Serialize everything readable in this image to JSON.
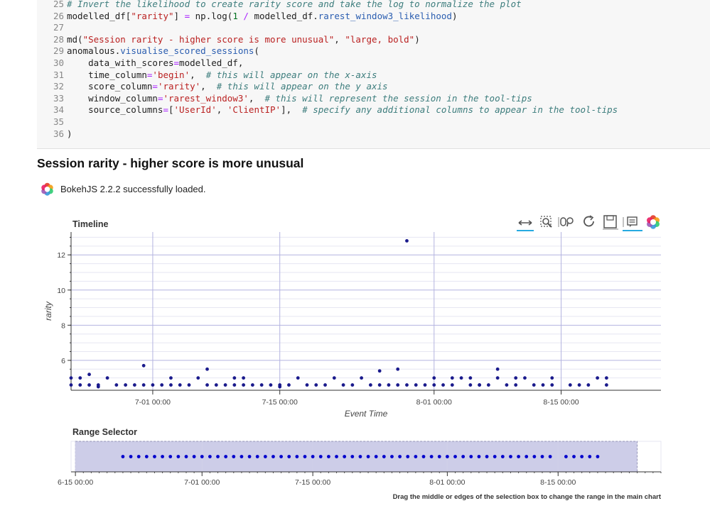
{
  "code_cell": {
    "line_numbers": [
      "25",
      "26",
      "27",
      "28",
      "29",
      "30",
      "31",
      "32",
      "33",
      "34",
      "35",
      "36"
    ],
    "lines": [
      [
        {
          "t": "# Invert the likelihood to create rarity score and take the log to normalize the plot",
          "k": "c"
        }
      ],
      [
        {
          "t": "modelled_df["
        },
        {
          "t": "\"rarity\"",
          "k": "s"
        },
        {
          "t": "] "
        },
        {
          "t": "=",
          "k": "op"
        },
        {
          "t": " np.log("
        },
        {
          "t": "1",
          "k": "k"
        },
        {
          "t": " "
        },
        {
          "t": "/",
          "k": "op"
        },
        {
          "t": " modelled_df."
        },
        {
          "t": "rarest_window3_likelihood",
          "k": "a"
        },
        {
          "t": ")"
        }
      ],
      [],
      [
        {
          "t": "md("
        },
        {
          "t": "\"Session rarity - higher score is more unusual\"",
          "k": "s"
        },
        {
          "t": ", "
        },
        {
          "t": "\"large, bold\"",
          "k": "s"
        },
        {
          "t": ")"
        }
      ],
      [
        {
          "t": "anomalous."
        },
        {
          "t": "visualise_scored_sessions",
          "k": "a"
        },
        {
          "t": "("
        }
      ],
      [
        {
          "t": "    data_with_scores"
        },
        {
          "t": "=",
          "k": "op"
        },
        {
          "t": "modelled_df,"
        }
      ],
      [
        {
          "t": "    time_column"
        },
        {
          "t": "=",
          "k": "op"
        },
        {
          "t": "'begin'",
          "k": "s"
        },
        {
          "t": ",  "
        },
        {
          "t": "# this will appear on the x-axis",
          "k": "c"
        }
      ],
      [
        {
          "t": "    score_column"
        },
        {
          "t": "=",
          "k": "op"
        },
        {
          "t": "'rarity'",
          "k": "s"
        },
        {
          "t": ",  "
        },
        {
          "t": "# this will appear on the y axis",
          "k": "c"
        }
      ],
      [
        {
          "t": "    window_column"
        },
        {
          "t": "=",
          "k": "op"
        },
        {
          "t": "'rarest_window3'",
          "k": "s"
        },
        {
          "t": ",  "
        },
        {
          "t": "# this will represent the session in the tool-tips",
          "k": "c"
        }
      ],
      [
        {
          "t": "    source_columns"
        },
        {
          "t": "=",
          "k": "op"
        },
        {
          "t": "["
        },
        {
          "t": "'UserId'",
          "k": "s"
        },
        {
          "t": ", "
        },
        {
          "t": "'ClientIP'",
          "k": "s"
        },
        {
          "t": "],  "
        },
        {
          "t": "# specify any additional columns to appear in the tool-tips",
          "k": "c"
        }
      ],
      [],
      [
        {
          "t": ")"
        }
      ]
    ]
  },
  "heading": "Session rarity - higher score is more unusual",
  "bokeh_message": "BokehJS 2.2.2 successfully loaded.",
  "toolbar": {
    "tools": [
      "x-pan-icon",
      "box-zoom-icon",
      "wheel-zoom-icon",
      "reset-icon",
      "save-icon",
      "hover-icon",
      "bokeh-logo-icon"
    ],
    "active": [
      "x-pan-icon",
      "hover-icon"
    ]
  },
  "colors": {
    "point": "#1a1a8c",
    "range_box": "#c8c8e6",
    "grid_major": "#b4b4e0",
    "grid_minor": "#e6e6f2"
  },
  "range_hint": "Drag the middle or edges of the selection box to change the range in the main chart",
  "chart_data": [
    {
      "type": "scatter",
      "title": "Timeline",
      "xlabel": "Event Time",
      "ylabel": "rarity",
      "x_ticks": [
        "7-01 00:00",
        "7-15 00:00",
        "8-01 00:00",
        "8-15 00:00"
      ],
      "y_ticks": [
        6,
        8,
        10,
        12
      ],
      "xlim": [
        "06-22",
        "08-26"
      ],
      "ylim": [
        4.3,
        13.3
      ],
      "grid": true,
      "points": [
        [
          "06-22",
          5.0
        ],
        [
          "06-22",
          4.6
        ],
        [
          "06-23",
          5.0
        ],
        [
          "06-23",
          4.6
        ],
        [
          "06-24",
          5.2
        ],
        [
          "06-24",
          4.6
        ],
        [
          "06-25",
          4.6
        ],
        [
          "06-25",
          4.5
        ],
        [
          "06-26",
          5.0
        ],
        [
          "06-27",
          4.6
        ],
        [
          "06-28",
          4.6
        ],
        [
          "06-29",
          4.6
        ],
        [
          "06-30",
          4.6
        ],
        [
          "06-30",
          5.7
        ],
        [
          "07-01",
          4.6
        ],
        [
          "07-02",
          4.6
        ],
        [
          "07-03",
          4.6
        ],
        [
          "07-03",
          5.0
        ],
        [
          "07-04",
          4.6
        ],
        [
          "07-05",
          4.6
        ],
        [
          "07-06",
          5.0
        ],
        [
          "07-07",
          4.6
        ],
        [
          "07-07",
          5.5
        ],
        [
          "07-08",
          4.6
        ],
        [
          "07-09",
          4.6
        ],
        [
          "07-10",
          5.0
        ],
        [
          "07-10",
          4.6
        ],
        [
          "07-11",
          5.0
        ],
        [
          "07-11",
          4.6
        ],
        [
          "07-12",
          4.6
        ],
        [
          "07-13",
          4.6
        ],
        [
          "07-14",
          4.6
        ],
        [
          "07-15",
          4.6
        ],
        [
          "07-15",
          4.5
        ],
        [
          "07-16",
          4.6
        ],
        [
          "07-17",
          5.0
        ],
        [
          "07-18",
          4.6
        ],
        [
          "07-19",
          4.6
        ],
        [
          "07-20",
          4.6
        ],
        [
          "07-21",
          5.0
        ],
        [
          "07-22",
          4.6
        ],
        [
          "07-23",
          4.6
        ],
        [
          "07-24",
          5.0
        ],
        [
          "07-25",
          4.6
        ],
        [
          "07-26",
          5.4
        ],
        [
          "07-26",
          4.6
        ],
        [
          "07-27",
          4.6
        ],
        [
          "07-28",
          5.5
        ],
        [
          "07-28",
          4.6
        ],
        [
          "07-29",
          4.6
        ],
        [
          "07-29",
          12.8
        ],
        [
          "07-30",
          4.6
        ],
        [
          "07-31",
          4.6
        ],
        [
          "08-01",
          4.6
        ],
        [
          "08-01",
          5.0
        ],
        [
          "08-02",
          4.6
        ],
        [
          "08-03",
          4.6
        ],
        [
          "08-03",
          5.0
        ],
        [
          "08-04",
          5.0
        ],
        [
          "08-05",
          4.6
        ],
        [
          "08-05",
          5.0
        ],
        [
          "08-06",
          4.6
        ],
        [
          "08-06",
          4.6
        ],
        [
          "08-07",
          4.6
        ],
        [
          "08-08",
          5.0
        ],
        [
          "08-08",
          5.5
        ],
        [
          "08-09",
          4.6
        ],
        [
          "08-10",
          4.6
        ],
        [
          "08-10",
          5.0
        ],
        [
          "08-11",
          5.0
        ],
        [
          "08-12",
          4.6
        ],
        [
          "08-13",
          4.6
        ],
        [
          "08-14",
          4.6
        ],
        [
          "08-14",
          5.0
        ],
        [
          "08-16",
          4.6
        ],
        [
          "08-17",
          4.6
        ],
        [
          "08-18",
          4.6
        ],
        [
          "08-19",
          5.0
        ],
        [
          "08-20",
          5.0
        ],
        [
          "08-20",
          4.6
        ]
      ]
    },
    {
      "type": "scatter",
      "title": "Range Selector",
      "x_ticks": [
        "6-15 00:00",
        "7-01 00:00",
        "7-15 00:00",
        "8-01 00:00",
        "8-15 00:00"
      ],
      "xlim": [
        "06-15",
        "08-28"
      ],
      "selection": [
        "06-15",
        "08-25"
      ],
      "points_x": [
        "06-21",
        "06-22",
        "06-23",
        "06-24",
        "06-25",
        "06-26",
        "06-27",
        "06-28",
        "06-29",
        "06-30",
        "07-01",
        "07-02",
        "07-03",
        "07-04",
        "07-05",
        "07-06",
        "07-07",
        "07-08",
        "07-09",
        "07-10",
        "07-11",
        "07-12",
        "07-13",
        "07-14",
        "07-15",
        "07-16",
        "07-17",
        "07-18",
        "07-19",
        "07-20",
        "07-21",
        "07-22",
        "07-23",
        "07-24",
        "07-25",
        "07-26",
        "07-27",
        "07-28",
        "07-29",
        "07-30",
        "07-31",
        "08-01",
        "08-02",
        "08-03",
        "08-04",
        "08-05",
        "08-06",
        "08-07",
        "08-08",
        "08-09",
        "08-10",
        "08-11",
        "08-12",
        "08-13",
        "08-14",
        "08-16",
        "08-17",
        "08-18",
        "08-19",
        "08-20"
      ]
    }
  ]
}
